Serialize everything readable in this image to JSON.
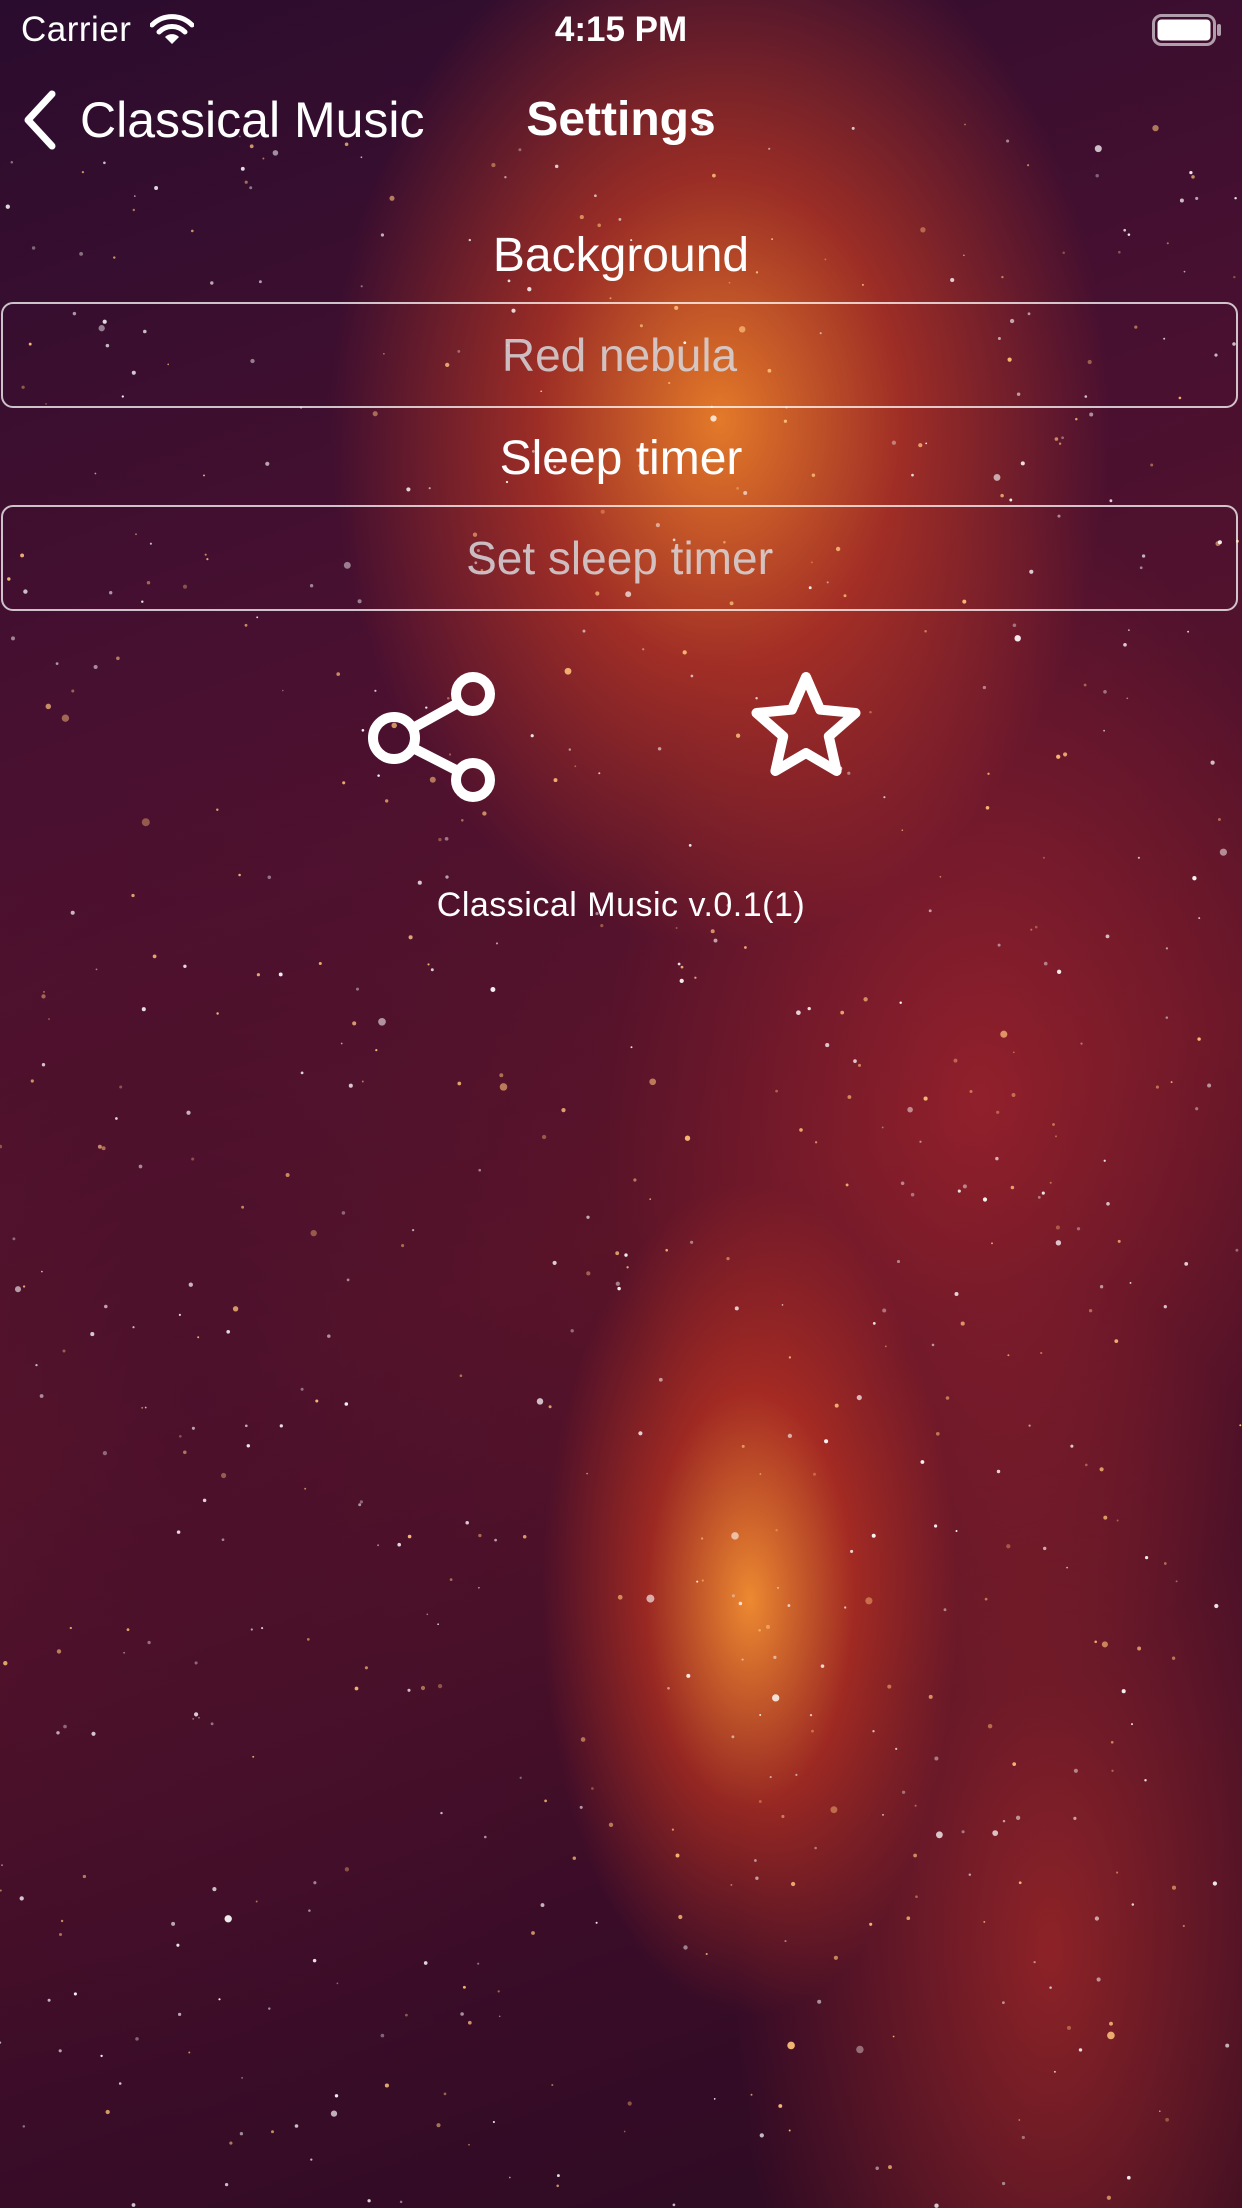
{
  "status_bar": {
    "carrier": "Carrier",
    "time": "4:15 PM",
    "icons": [
      "wifi-icon",
      "battery-icon"
    ]
  },
  "nav": {
    "back_label": "Classical Music",
    "title": "Settings",
    "back_icon": "chevron-left-icon"
  },
  "settings": {
    "background_label": "Background",
    "background_value": "Red nebula",
    "sleep_timer_label": "Sleep timer",
    "sleep_timer_placeholder": "Set sleep timer"
  },
  "actions": [
    {
      "icon": "share-icon"
    },
    {
      "icon": "star-icon"
    }
  ],
  "app_version": "Classical Music v.0.1(1)",
  "colors": {
    "text": "#ffffff",
    "field_text": "#d7d7dc",
    "field_border": "#ffffff",
    "nebula_glow": "#ff8c28",
    "background_dark": "#2a0c2e"
  }
}
